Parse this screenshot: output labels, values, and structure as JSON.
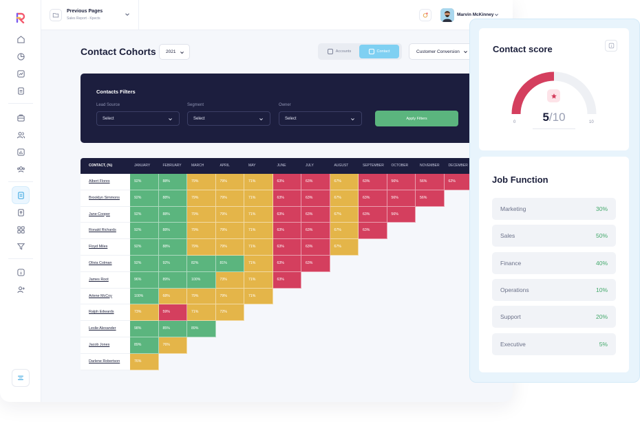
{
  "topbar": {
    "page_picker_title": "Previous Pages",
    "page_picker_subtitle": "Sales Report - Kpects",
    "user_name": "Marvin McKinney"
  },
  "header": {
    "title": "Contact Cohorts",
    "year": "2021",
    "tabs": [
      {
        "label": "Accounts",
        "active": false
      },
      {
        "label": "Contact",
        "active": true
      }
    ],
    "conversion_select": "Customer Conversion"
  },
  "filters": {
    "title": "Contacts Filters",
    "fields": [
      {
        "label": "Lead Source",
        "value": "Select"
      },
      {
        "label": "Segment",
        "value": "Select"
      },
      {
        "label": "Owner",
        "value": "Select"
      }
    ],
    "apply_label": "Apply Filters"
  },
  "cohort": {
    "header_first": "CONTACT, (%)",
    "months": [
      "JANUARY",
      "FEBRUARY",
      "MARCH",
      "APRIL",
      "MAY",
      "JUNE",
      "JULY",
      "AUGUST",
      "SEPTEMBER",
      "OCTOBER",
      "NOVEMBER",
      "DECEMBER"
    ],
    "rows": [
      {
        "name": "Albert Flores",
        "values": [
          "92%",
          "88%",
          "79%",
          "79%",
          "71%",
          "63%",
          "63%",
          "67%",
          "63%",
          "56%",
          "56%",
          "62%"
        ]
      },
      {
        "name": "Brooklyn Simmons",
        "values": [
          "92%",
          "88%",
          "79%",
          "79%",
          "71%",
          "63%",
          "63%",
          "67%",
          "63%",
          "56%",
          "56%"
        ]
      },
      {
        "name": "Jane Cooper",
        "values": [
          "92%",
          "88%",
          "79%",
          "79%",
          "71%",
          "63%",
          "63%",
          "67%",
          "63%",
          "56%"
        ]
      },
      {
        "name": "Ronald Richards",
        "values": [
          "92%",
          "88%",
          "79%",
          "79%",
          "71%",
          "63%",
          "63%",
          "67%",
          "63%"
        ]
      },
      {
        "name": "Floyd Miles",
        "values": [
          "92%",
          "88%",
          "79%",
          "79%",
          "71%",
          "63%",
          "63%",
          "67%"
        ]
      },
      {
        "name": "Olivia Colman",
        "values": [
          "92%",
          "92%",
          "82%",
          "81%",
          "71%",
          "63%",
          "63%"
        ]
      },
      {
        "name": "James Root",
        "values": [
          "96%",
          "89%",
          "100%",
          "73%",
          "71%",
          "63%"
        ]
      },
      {
        "name": "Arlene McCoy",
        "values": [
          "100%",
          "68%",
          "79%",
          "79%",
          "71%"
        ]
      },
      {
        "name": "Ralph Edwards",
        "values": [
          "73%",
          "59%",
          "71%",
          "72%"
        ]
      },
      {
        "name": "Leslie Alexander",
        "values": [
          "98%",
          "85%",
          "89%"
        ]
      },
      {
        "name": "Jacob Jones",
        "values": [
          "89%",
          "76%"
        ]
      },
      {
        "name": "Darlene Robertson",
        "values": [
          "76%"
        ]
      }
    ],
    "colors": {
      "green": "#5bb57e",
      "yellow": "#e4b549",
      "red": "#d43f5e"
    }
  },
  "score": {
    "title": "Contact score",
    "value": "5",
    "out_of": "/10",
    "min": "0",
    "max": "10",
    "fraction": 0.5,
    "accent": "#d43f5e"
  },
  "job_function": {
    "title": "Job Function",
    "items": [
      {
        "label": "Marketing",
        "pct": "30%"
      },
      {
        "label": "Sales",
        "pct": "50%"
      },
      {
        "label": "Finance",
        "pct": "40%"
      },
      {
        "label": "Operations",
        "pct": "10%"
      },
      {
        "label": "Support",
        "pct": "20%"
      },
      {
        "label": "Executive",
        "pct": "5%"
      }
    ]
  }
}
